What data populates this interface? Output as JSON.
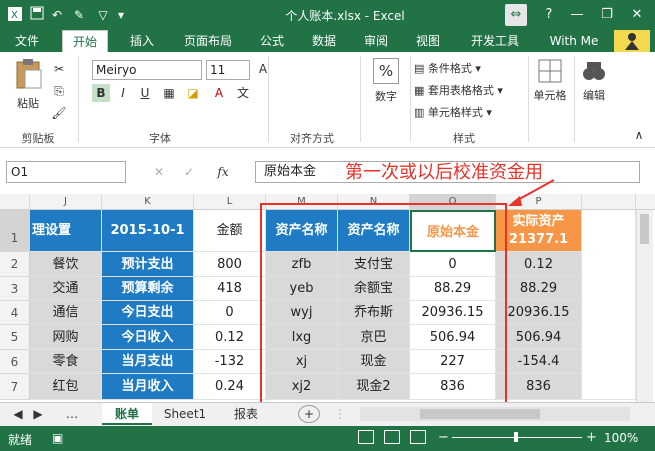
{
  "window": {
    "title": "个人账本.xlsx - Excel",
    "help": "?",
    "minimize": "—",
    "restore": "❐",
    "close": "✕"
  },
  "tabs": [
    "文件",
    "开始",
    "插入",
    "页面布局",
    "公式",
    "数据",
    "审阅",
    "视图",
    "开发工具",
    "With Me"
  ],
  "ribbon": {
    "clipboard": {
      "paste": "粘贴",
      "label": "剪贴板"
    },
    "font": {
      "name": "Meiryo",
      "size": "11",
      "bold": "B",
      "italic": "I",
      "underline": "U",
      "label": "字体"
    },
    "align": {
      "label": "对齐方式"
    },
    "number": {
      "btn": "数字",
      "symbol": "%"
    },
    "styles": {
      "cond": "条件格式",
      "table": "套用表格格式",
      "cell": "单元格样式",
      "label": "样式"
    },
    "cells": {
      "btn": "单元格"
    },
    "edit": {
      "btn": "编辑"
    }
  },
  "formula_bar": {
    "name_box": "O1",
    "fx": "fx",
    "cancel": "✕",
    "enter": "✓",
    "content": "原始本金"
  },
  "annotation": "第一次或以后校准资金用",
  "columns": [
    "J",
    "K",
    "L",
    "M",
    "N",
    "O",
    "P"
  ],
  "rows": [
    "1",
    "2",
    "3",
    "4",
    "5",
    "6",
    "7"
  ],
  "sheet": {
    "J": [
      "理设置",
      "餐饮",
      "交通",
      "通信",
      "网购",
      "零食",
      "红包"
    ],
    "K": [
      "2015-10-1",
      "预计支出",
      "预算剩余",
      "今日支出",
      "今日收入",
      "当月支出",
      "当月收入"
    ],
    "L": [
      "金额",
      "800",
      "418",
      "0",
      "0.12",
      "-132",
      "0.24"
    ],
    "M": [
      "资产名称",
      "zfb",
      "yeb",
      "wyj",
      "lxg",
      "xj",
      "xj2"
    ],
    "N": [
      "资产名称",
      "支付宝",
      "余额宝",
      "乔布斯",
      "京巴",
      "现金",
      "现金2"
    ],
    "O": [
      "原始本金",
      "0",
      "88.29",
      "20936.15",
      "506.94",
      "227",
      "836"
    ],
    "P_head": [
      "实际资产",
      "21377.1"
    ],
    "P": [
      "0.12",
      "88.29",
      "20936.15",
      "506.94",
      "-154.4",
      "836"
    ]
  },
  "sheet_tabs": [
    "账单",
    "Sheet1",
    "报表"
  ],
  "add_sheet": "+",
  "status": {
    "ready": "就绪",
    "zoom": "100%"
  },
  "colors": {
    "excel_green": "#217346",
    "header_blue": "#1e7bc4",
    "orange": "#f79646",
    "highlight_red": "#e8332a"
  }
}
